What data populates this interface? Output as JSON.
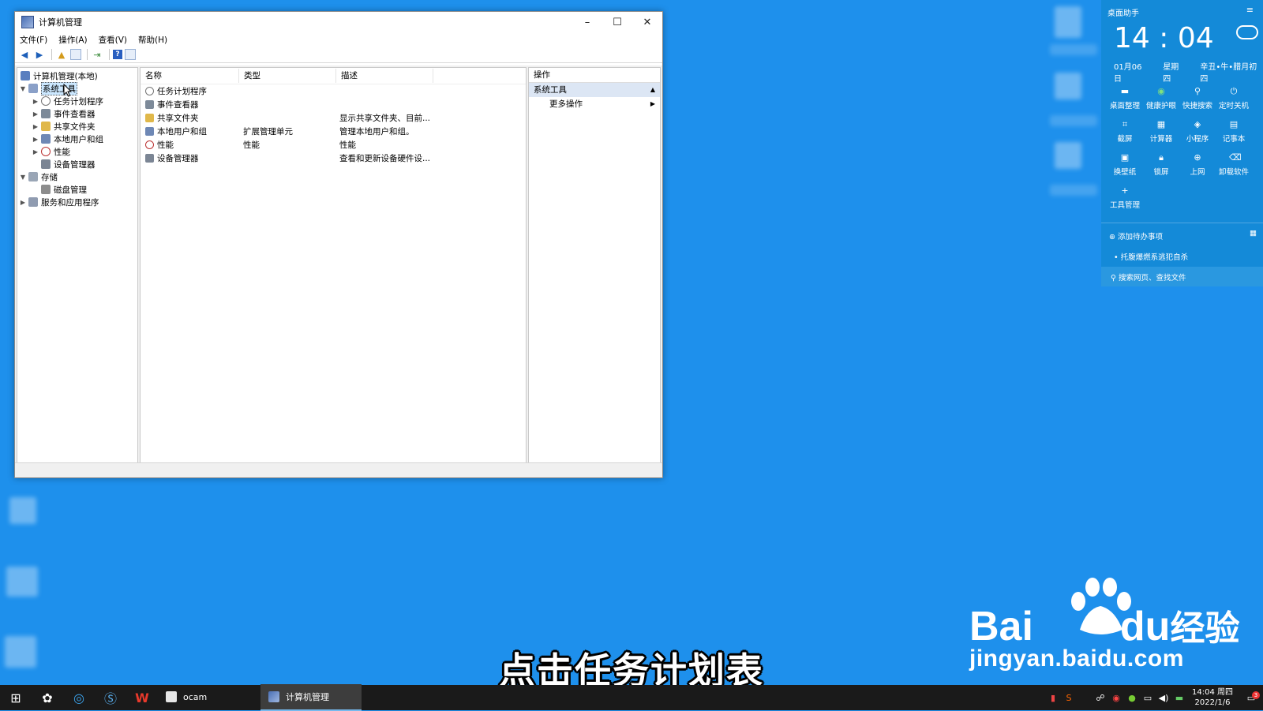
{
  "window": {
    "title": "计算机管理",
    "controls": {
      "minimize": "–",
      "maximize": "☐",
      "close": "✕"
    },
    "menu": [
      "文件(F)",
      "操作(A)",
      "查看(V)",
      "帮助(H)"
    ]
  },
  "tree": {
    "root": "计算机管理(本地)",
    "system_tools": "系统工具",
    "task_scheduler": "任务计划程序",
    "event_viewer": "事件查看器",
    "shared_folders": "共享文件夹",
    "local_users": "本地用户和组",
    "performance": "性能",
    "device_manager": "设备管理器",
    "storage": "存储",
    "disk_management": "磁盘管理",
    "services": "服务和应用程序"
  },
  "list": {
    "headers": [
      "名称",
      "类型",
      "描述"
    ],
    "rows": [
      {
        "name": "任务计划程序",
        "type": "",
        "desc": ""
      },
      {
        "name": "事件查看器",
        "type": "",
        "desc": ""
      },
      {
        "name": "共享文件夹",
        "type": "",
        "desc": "显示共享文件夹、目前..."
      },
      {
        "name": "本地用户和组",
        "type": "扩展管理单元",
        "desc": "管理本地用户和组。"
      },
      {
        "name": "性能",
        "type": "性能",
        "desc": "性能"
      },
      {
        "name": "设备管理器",
        "type": "",
        "desc": "查看和更新设备硬件设..."
      }
    ]
  },
  "actions": {
    "header": "操作",
    "section": "系统工具",
    "more": "更多操作"
  },
  "widget": {
    "title": "桌面助手",
    "time": "14 : 04",
    "date": "01月06日",
    "weekday": "星期四",
    "lunar": "辛丑•牛•腊月初四",
    "tools": [
      "桌面整理",
      "健康护眼",
      "快捷搜索",
      "定时关机",
      "截屏",
      "计算器",
      "小程序",
      "记事本",
      "换壁纸",
      "锁屏",
      "上网",
      "卸载软件",
      "工具管理"
    ],
    "todo": "添加待办事项",
    "tip": "托腹爆燃系逃犯自杀",
    "search": "搜索网页、查找文件"
  },
  "subtitle": "点击任务计划表",
  "watermark": {
    "brand": "Bai",
    "brand2": "du",
    "cn": "经验",
    "url": "jingyan.baidu.com"
  },
  "taskbar": {
    "apps": [
      "ocam",
      "计算机管理"
    ],
    "time": "14:04 周四",
    "date": "2022/1/6",
    "notif_count": "3"
  }
}
